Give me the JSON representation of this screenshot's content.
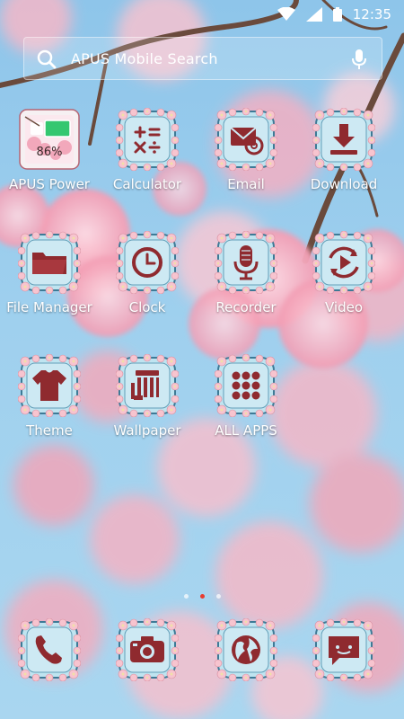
{
  "status_bar": {
    "time": "12:35"
  },
  "search": {
    "placeholder": "APUS Mobile Search"
  },
  "apps": [
    {
      "label": "APUS Power",
      "icon": "battery-icon",
      "badge": "86%"
    },
    {
      "label": "Calculator",
      "icon": "calculator-icon"
    },
    {
      "label": "Email",
      "icon": "email-icon"
    },
    {
      "label": "Download",
      "icon": "download-icon"
    },
    {
      "label": "File Manager",
      "icon": "folder-icon"
    },
    {
      "label": "Clock",
      "icon": "clock-icon"
    },
    {
      "label": "Recorder",
      "icon": "microphone-icon"
    },
    {
      "label": "Video",
      "icon": "play-icon"
    },
    {
      "label": "Theme",
      "icon": "tshirt-icon"
    },
    {
      "label": "Wallpaper",
      "icon": "wallpaper-icon"
    },
    {
      "label": "ALL APPS",
      "icon": "grid-icon"
    }
  ],
  "dock": [
    {
      "icon": "phone-icon"
    },
    {
      "icon": "camera-icon"
    },
    {
      "icon": "browser-icon"
    },
    {
      "icon": "messages-icon"
    }
  ],
  "page_indicator": {
    "count": 3,
    "active": 2
  },
  "colors": {
    "icon_red": "#8f2a2f",
    "icon_bg": "#bfe4f0",
    "frame": "#3d7a96",
    "flower": "#f7c4cf"
  }
}
